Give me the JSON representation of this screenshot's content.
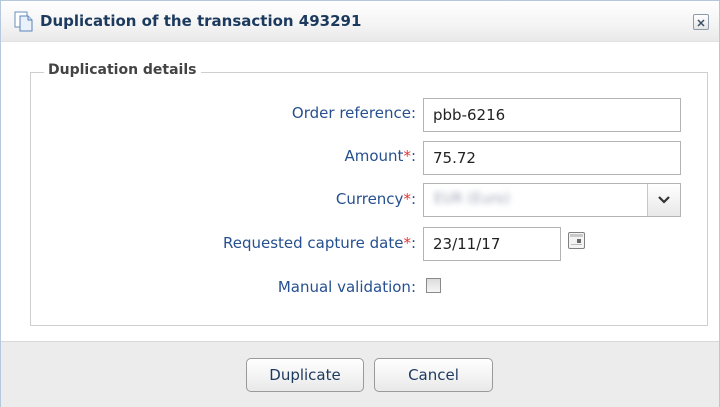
{
  "dialog": {
    "title": "Duplication of the transaction 493291",
    "title_icon": "document-copy-icon",
    "close_icon": "close-icon"
  },
  "form": {
    "legend": "Duplication details",
    "required_marker": "*",
    "order_reference": {
      "label": "Order reference:",
      "value": "pbb-6216"
    },
    "amount": {
      "label": "Amount",
      "suffix": ":",
      "value": "75.72"
    },
    "currency": {
      "label": "Currency",
      "suffix": ":",
      "value": "EUR (Euro)",
      "value_blurred": true,
      "arrow_icon": "chevron-down-icon"
    },
    "capture_date": {
      "label": "Requested capture date",
      "suffix": ":",
      "value": "23/11/17",
      "calendar_icon": "calendar-icon"
    },
    "manual_validation": {
      "label": "Manual validation:",
      "checked": false
    }
  },
  "footer": {
    "duplicate_label": "Duplicate",
    "cancel_label": "Cancel"
  },
  "colors": {
    "label": "#26508f",
    "required": "#e23636",
    "title": "#1c3a5e",
    "footer_bg": "#ececec"
  }
}
